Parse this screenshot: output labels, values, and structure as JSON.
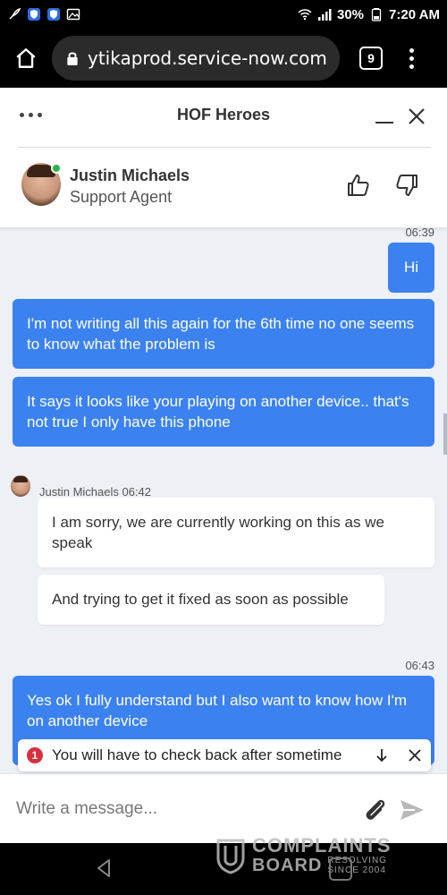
{
  "status_bar": {
    "battery": "30%",
    "time": "7:20 AM"
  },
  "browser": {
    "url": "ytikaprod.service-now.com",
    "tab_count": "9"
  },
  "chat_header": {
    "title": "HOF Heroes",
    "agent_name": "Justin Michaels",
    "agent_role": "Support Agent",
    "agent_status_color": "#2bb14c"
  },
  "messages": {
    "time_1": "06:39",
    "out_1": "Hi",
    "out_2": "I'm not writing all this again for the 6th time no one seems to know what the problem is",
    "out_3": "It says it looks like your playing on another device.. that's not true I only have this phone",
    "agent_meta": "Justin Michaels 06:42",
    "in_1": "I am sorry, we are currently working on this as we speak",
    "in_2": "And trying to get it fixed as soon as possible",
    "time_2": "06:43",
    "out_4": "Yes ok I fully understand but I also want to know how I'm on another device"
  },
  "notification": {
    "badge": "1",
    "text": "You will have to check back after sometime"
  },
  "composer": {
    "placeholder": "Write a message..."
  },
  "watermark": {
    "line1": "COMPLAINTS",
    "line2": "BOARD",
    "tagline1": "RESOLVING",
    "tagline2": "SINCE 2004"
  },
  "colors": {
    "accent": "#3b82f0",
    "chat_background": "#edf0f5",
    "badge": "#d93040"
  },
  "icons": [
    "rocket-icon",
    "shield-icon",
    "shield-icon",
    "image-icon",
    "wifi-icon",
    "signal-icon",
    "battery-icon",
    "home-icon",
    "lock-icon",
    "tabs-icon",
    "menu-icon",
    "more-dots-icon",
    "minimize-icon",
    "close-icon",
    "thumbs-up-icon",
    "thumbs-down-icon",
    "arrow-down-icon",
    "paperclip-icon",
    "send-icon",
    "back-icon"
  ]
}
